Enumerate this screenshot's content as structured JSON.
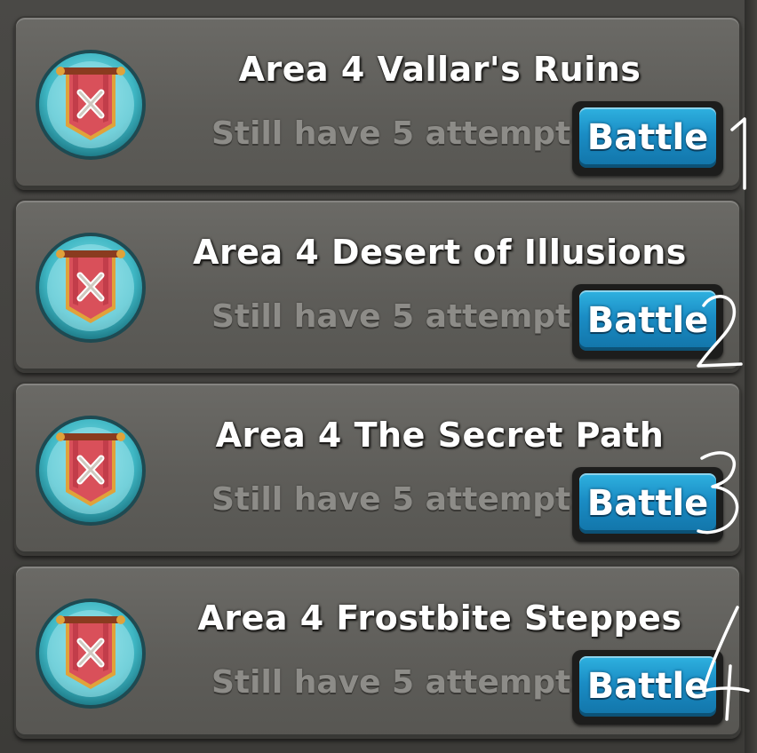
{
  "areas": [
    {
      "title": "Area 4  Vallar's Ruins",
      "attempts": "Still have 5 attempts",
      "button": "Battle"
    },
    {
      "title": "Area 4  Desert of Illusions",
      "attempts": "Still have 5 attempts",
      "button": "Battle"
    },
    {
      "title": "Area 4  The Secret Path",
      "attempts": "Still have 5 attempts",
      "button": "Battle"
    },
    {
      "title": "Area 4  Frostbite Steppes",
      "attempts": "Still have 5 attempts",
      "button": "Battle"
    }
  ],
  "icons": {
    "emblem": "battle-banner-icon"
  },
  "colors": {
    "button_blue": "#1a8cc4",
    "banner_red": "#d9505a",
    "emblem_ring": "#39b6c2",
    "card_gray": "#5e5d59"
  }
}
